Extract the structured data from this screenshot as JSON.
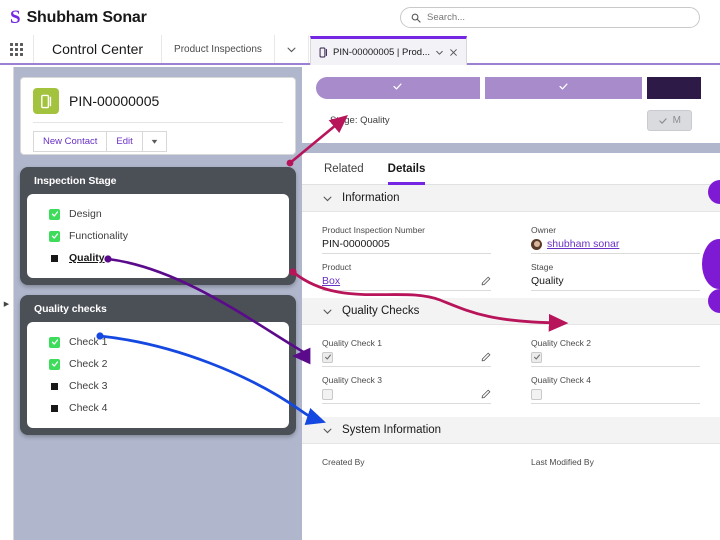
{
  "header": {
    "brand_logo": "S",
    "brand_name": "Shubham Sonar",
    "search_placeholder": "Search...",
    "search_value": "",
    "search_icon": "search-icon"
  },
  "app_nav": {
    "waffle_icon": "app-launcher-icon",
    "app_name": "Control Center",
    "nav_items": [
      {
        "label": "Product Inspections"
      }
    ],
    "chevron_icon": "chevron-down-icon"
  },
  "workspace_tabs": [
    {
      "icon": "mobile-record-icon",
      "label": "PIN-00000005 | Prod...",
      "caret_icon": "chevron-down-icon",
      "close_icon": "close-icon",
      "active": true
    }
  ],
  "rail": {
    "expand_icon": "chevron-right-icon"
  },
  "highlights": {
    "object_icon": "mobile-record-icon",
    "record_title": "PIN-00000005",
    "buttons": [
      {
        "label": "New Contact",
        "name": "new-contact-button"
      },
      {
        "label": "Edit",
        "name": "edit-button"
      }
    ],
    "more_caret": "chevron-down-icon"
  },
  "overlays": [
    {
      "title": "Inspection Stage",
      "name": "inspection-stage-panel",
      "items": [
        {
          "label": "Design",
          "checked": true,
          "active": false
        },
        {
          "label": "Functionality",
          "checked": true,
          "active": false
        },
        {
          "label": "Quality",
          "checked": false,
          "active": true
        }
      ]
    },
    {
      "title": "Quality checks",
      "name": "quality-checks-panel",
      "items": [
        {
          "label": "Check 1",
          "checked": true,
          "active": false
        },
        {
          "label": "Check 2",
          "checked": true,
          "active": false
        },
        {
          "label": "Check 3",
          "checked": false,
          "active": false
        },
        {
          "label": "Check 4",
          "checked": false,
          "active": false
        }
      ]
    }
  ],
  "path": {
    "steps": [
      {
        "state": "done",
        "check_icon": "check-icon"
      },
      {
        "state": "done",
        "check_icon": "check-icon"
      },
      {
        "state": "current",
        "check_icon": ""
      }
    ],
    "stage_label": "Stage: Quality",
    "mark_button": {
      "label": "M",
      "icon": "check-icon"
    }
  },
  "tabs": [
    {
      "label": "Related",
      "active": false
    },
    {
      "label": "Details",
      "active": true
    }
  ],
  "sections": [
    {
      "title": "Information",
      "name": "information-section",
      "chevron_icon": "chevron-down-icon",
      "fields": [
        {
          "label": "Product Inspection Number",
          "value": "PIN-00000005",
          "type": "text",
          "editable": false
        },
        {
          "label": "Owner",
          "value": "shubham sonar",
          "type": "user-link",
          "editable": false
        },
        {
          "label": "Product",
          "value": "Box",
          "type": "link",
          "editable": true
        },
        {
          "label": "Stage",
          "value": "Quality",
          "type": "text",
          "editable": false
        }
      ]
    },
    {
      "title": "Quality Checks",
      "name": "quality-checks-section",
      "chevron_icon": "chevron-down-icon",
      "fields": [
        {
          "label": "Quality Check 1",
          "value": "",
          "type": "checkbox",
          "checked": true,
          "editable": true
        },
        {
          "label": "Quality Check 2",
          "value": "",
          "type": "checkbox",
          "checked": true,
          "editable": false
        },
        {
          "label": "Quality Check 3",
          "value": "",
          "type": "checkbox",
          "checked": false,
          "editable": true
        },
        {
          "label": "Quality Check 4",
          "value": "",
          "type": "checkbox",
          "checked": false,
          "editable": false
        }
      ]
    },
    {
      "title": "System Information",
      "name": "system-information-section",
      "chevron_icon": "chevron-down-icon",
      "fields": [
        {
          "label": "Created By",
          "value": "",
          "type": "text",
          "editable": false
        },
        {
          "label": "Last Modified By",
          "value": "",
          "type": "text",
          "editable": false
        }
      ]
    }
  ],
  "colors": {
    "brand_purple": "#7526e3",
    "path_done": "#a78bca",
    "path_current": "#2e1a47",
    "overlay_dark": "#4b4f56",
    "check_green": "#3ddc5b",
    "object_green": "#a3c23d",
    "page_bg": "#b0b7cd",
    "annotation_crimson": "#b8145a",
    "annotation_purple": "#5b0a8c",
    "annotation_blue": "#1548e0",
    "edge_circle": "#7f1ad4"
  }
}
